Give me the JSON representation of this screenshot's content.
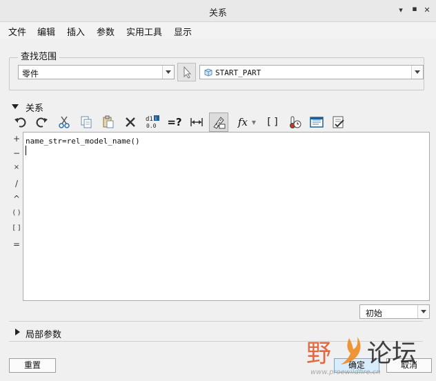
{
  "window": {
    "title": "关系"
  },
  "menu": [
    "文件",
    "编辑",
    "插入",
    "参数",
    "实用工具",
    "显示"
  ],
  "lookup": {
    "legend": "查找范围",
    "scope_value": "零件",
    "part_value": "START_PART"
  },
  "relations": {
    "header": "关系",
    "toolbar": [
      {
        "name": "undo-icon"
      },
      {
        "name": "redo-icon"
      },
      {
        "name": "cut-icon"
      },
      {
        "name": "copy-icon"
      },
      {
        "name": "paste-icon"
      },
      {
        "name": "delete-icon"
      },
      {
        "name": "switch-dims-icon",
        "label": "d1"
      },
      {
        "name": "evaluate-icon",
        "label": "=?"
      },
      {
        "name": "show-dim-icon"
      },
      {
        "name": "unit-sensitive-icon"
      },
      {
        "name": "insert-function-icon",
        "label": "fx"
      },
      {
        "name": "insert-parameter-icon",
        "label": "[ ]"
      },
      {
        "name": "sort-relations-icon"
      },
      {
        "name": "verify-relations-icon"
      },
      {
        "name": "execute-relations-icon"
      }
    ],
    "operators": [
      "+",
      "−",
      "×",
      "/",
      "^",
      "( )",
      "[ ]",
      "="
    ],
    "editor_text": "name_str=rel_model_name()",
    "initial_select": "初始"
  },
  "local_params": {
    "header": "局部参数"
  },
  "buttons": {
    "reset": "重置",
    "ok": "确定",
    "cancel": "取消"
  },
  "watermark": {
    "brand": "野火论坛",
    "url": "www.proewildfire.cn"
  }
}
